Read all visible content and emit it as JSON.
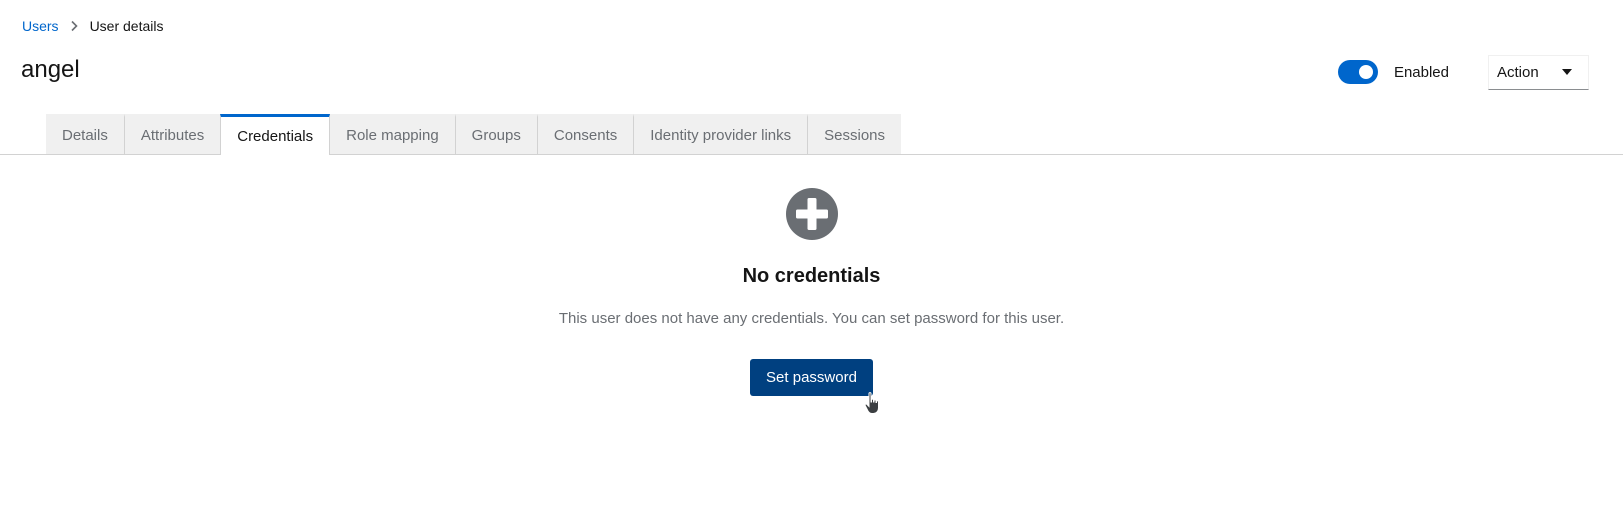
{
  "breadcrumb": {
    "parent": "Users",
    "separator_icon": "chevron-right-icon",
    "current": "User details"
  },
  "page": {
    "title": "angel"
  },
  "header": {
    "enabled_toggle": {
      "label": "Enabled",
      "on": true
    },
    "action_dropdown": {
      "label": "Action",
      "icon": "caret-down-icon"
    }
  },
  "tabs": [
    {
      "label": "Details",
      "active": false
    },
    {
      "label": "Attributes",
      "active": false
    },
    {
      "label": "Credentials",
      "active": true
    },
    {
      "label": "Role mapping",
      "active": false
    },
    {
      "label": "Groups",
      "active": false
    },
    {
      "label": "Consents",
      "active": false
    },
    {
      "label": "Identity provider links",
      "active": false
    },
    {
      "label": "Sessions",
      "active": false
    }
  ],
  "empty_state": {
    "icon": "plus-circle-icon",
    "title": "No credentials",
    "body": "This user does not have any credentials. You can set password for this user.",
    "button_label": "Set password"
  },
  "colors": {
    "link": "#0066cc",
    "accent": "#0066cc",
    "primary_button": "#004080",
    "icon_gray": "#6a6e73"
  }
}
